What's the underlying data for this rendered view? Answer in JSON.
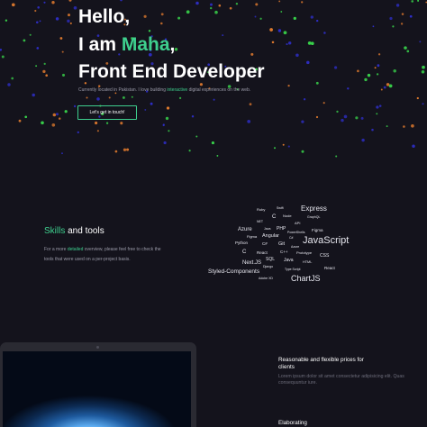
{
  "hero": {
    "line1": "Hello,",
    "line2_prefix": "I am ",
    "name": "Maha",
    "line2_suffix": ",",
    "line3": "Front End Developer",
    "subtitle_prefix": "Currently located in Pakistan. I love building ",
    "subtitle_highlight": "interactive",
    "subtitle_suffix": " digital experiences on the web.",
    "cta_label": "Let's get in touch!"
  },
  "skills": {
    "title_highlight": "Skills",
    "title_rest": " and tools",
    "desc_prefix": "For a more ",
    "desc_highlight": "detailed",
    "desc_rest": " overview, please feel free to check the tools that were used on a per-project basis."
  },
  "skill_cloud": [
    {
      "text": "Ruby"
    },
    {
      "text": "Swift"
    },
    {
      "text": "Express"
    },
    {
      "text": "C"
    },
    {
      "text": "Node"
    },
    {
      "text": "GraphQL"
    },
    {
      "text": "NET"
    },
    {
      "text": "API"
    },
    {
      "text": "Azure"
    },
    {
      "text": "Java"
    },
    {
      "text": "PHP"
    },
    {
      "text": "PowerShells"
    },
    {
      "text": "Figma"
    },
    {
      "text": "Figma"
    },
    {
      "text": "Angular"
    },
    {
      "text": "C#"
    },
    {
      "text": "JavaScript"
    },
    {
      "text": "Python"
    },
    {
      "text": "C#"
    },
    {
      "text": "Git"
    },
    {
      "text": "Azure"
    },
    {
      "text": "C"
    },
    {
      "text": "React"
    },
    {
      "text": "C++"
    },
    {
      "text": "Prototype"
    },
    {
      "text": "CSS"
    },
    {
      "text": "Next.JS"
    },
    {
      "text": "SQL"
    },
    {
      "text": "Java"
    },
    {
      "text": "HTML"
    },
    {
      "text": "Django"
    },
    {
      "text": "React"
    },
    {
      "text": "Styled-Components"
    },
    {
      "text": "Type Script"
    },
    {
      "text": "Adobe XD"
    },
    {
      "text": "ChartJS"
    }
  ],
  "pricing": {
    "title": "Reasonable and flexible prices for clients",
    "desc": "Lorem ipsum dolor sit amet consectetur adipisicing elit. Quas consequuntur iure."
  },
  "section_next": "Elaborating",
  "colors": {
    "background": "#14131c",
    "accent": "#3ecf8e",
    "dot_orange": "#e07a2e",
    "dot_green": "#38d24a",
    "dot_blue": "#2e2ec8"
  }
}
